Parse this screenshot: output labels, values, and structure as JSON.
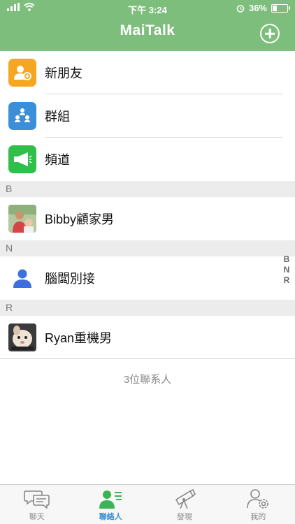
{
  "status": {
    "time": "下午 3:24",
    "battery": "36%",
    "battery_level": 0.36
  },
  "header": {
    "title": "MaiTalk"
  },
  "top_items": [
    {
      "label": "新朋友",
      "icon": "add-friend-icon",
      "color": "#f5a623"
    },
    {
      "label": "群組",
      "icon": "group-icon",
      "color": "#3b8ed8"
    },
    {
      "label": "頻道",
      "icon": "megaphone-icon",
      "color": "#2fbf4a"
    }
  ],
  "sections": [
    {
      "letter": "B",
      "contacts": [
        {
          "name": "Bibby顧家男"
        }
      ]
    },
    {
      "letter": "N",
      "contacts": [
        {
          "name": "腦闆別接"
        }
      ]
    },
    {
      "letter": "R",
      "contacts": [
        {
          "name": "Ryan重機男"
        }
      ]
    }
  ],
  "contact_count": "3位聯系人",
  "index_letters": [
    "B",
    "N",
    "R"
  ],
  "tabs": [
    {
      "label": "聊天",
      "icon": "chat-icon",
      "active": false
    },
    {
      "label": "聯絡人",
      "icon": "contacts-icon",
      "active": true
    },
    {
      "label": "發現",
      "icon": "telescope-icon",
      "active": false
    },
    {
      "label": "我的",
      "icon": "profile-settings-icon",
      "active": false
    }
  ]
}
